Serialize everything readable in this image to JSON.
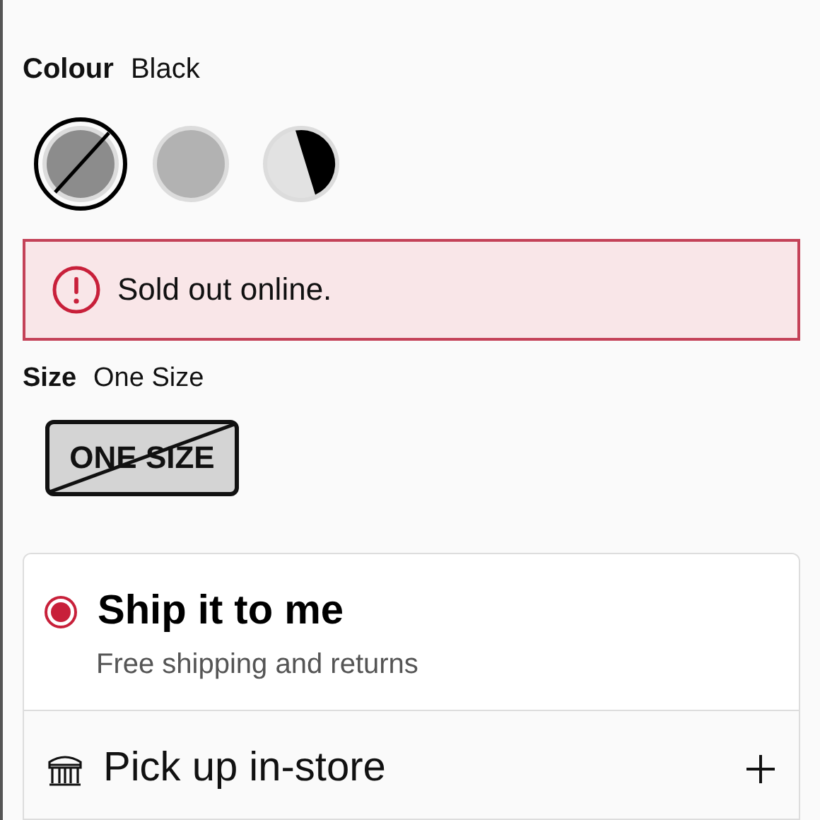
{
  "colour": {
    "label": "Colour",
    "value": "Black",
    "swatches": [
      {
        "kind": "solid",
        "color": "#8c8c8c",
        "selected": true,
        "unavailable": true
      },
      {
        "kind": "solid",
        "color": "#b2b2b2",
        "selected": false,
        "unavailable": false
      },
      {
        "kind": "split",
        "color": "#e2e2e2",
        "selected": false,
        "unavailable": false
      }
    ]
  },
  "alert": {
    "text": "Sold out online."
  },
  "size": {
    "label": "Size",
    "value": "One Size",
    "options": [
      {
        "label": "ONE SIZE",
        "selected": true,
        "unavailable": true
      }
    ]
  },
  "delivery": [
    {
      "kind": "radio",
      "title": "Ship it to me",
      "subtitle": "Free shipping and returns",
      "selected": true
    },
    {
      "kind": "expand",
      "title": "Pick up in-store"
    }
  ]
}
